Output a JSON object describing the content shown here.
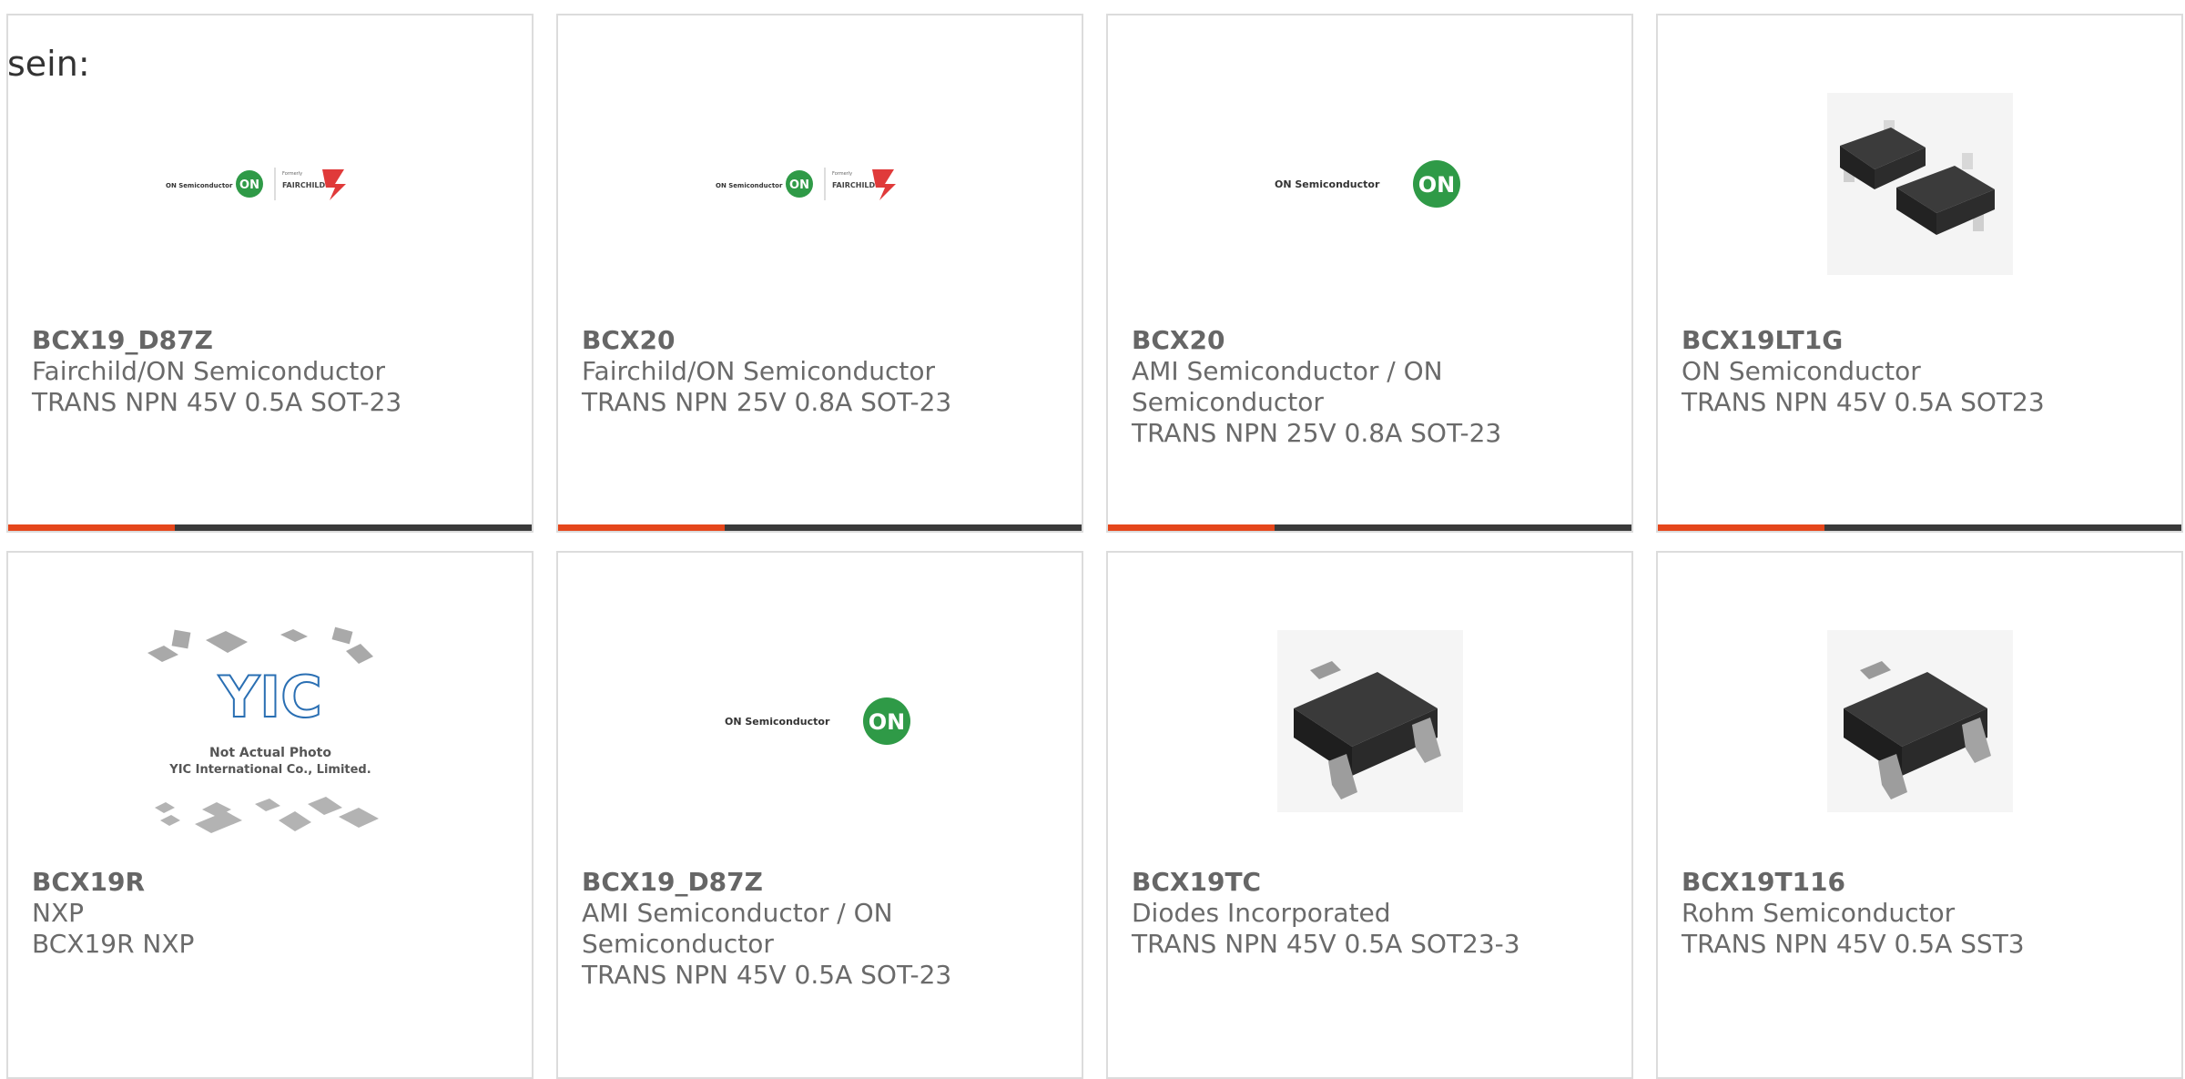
{
  "intro": "sein:",
  "accent_color": "#e5461b",
  "bar_color": "#3a3a3a",
  "products": [
    {
      "part": "BCX19_D87Z",
      "manufacturer": "Fairchild/ON Semiconductor",
      "description": "TRANS NPN 45V 0.5A SOT-23",
      "image": "on-fairchild-logo",
      "logo_on_text": "ON Semiconductor",
      "logo_on_mark": "ON",
      "logo_fc_small": "Formerly",
      "logo_fc_text": "FAIRCHILD."
    },
    {
      "part": "BCX20",
      "manufacturer": "Fairchild/ON Semiconductor",
      "description": "TRANS NPN 25V 0.8A SOT-23",
      "image": "on-fairchild-logo",
      "logo_on_text": "ON Semiconductor",
      "logo_on_mark": "ON",
      "logo_fc_small": "Formerly",
      "logo_fc_text": "FAIRCHILD."
    },
    {
      "part": "BCX20",
      "manufacturer": "AMI Semiconductor / ON Semiconductor",
      "description": "TRANS NPN 25V 0.8A SOT-23",
      "image": "on-semiconductor-logo",
      "logo_on_text": "ON Semiconductor",
      "logo_on_mark": "ON"
    },
    {
      "part": "BCX19LT1G",
      "manufacturer": "ON Semiconductor",
      "description": "TRANS NPN 45V 0.5A SOT23",
      "image": "sot23-package-photo"
    },
    {
      "part": "BCX19R",
      "manufacturer": "NXP",
      "description": "BCX19R NXP",
      "image": "not-actual-photo-placeholder",
      "placeholder_logo": "YIC",
      "placeholder_line1": "Not Actual Photo",
      "placeholder_line2": "YIC International Co., Limited."
    },
    {
      "part": "BCX19_D87Z",
      "manufacturer": "AMI Semiconductor / ON Semiconductor",
      "description": "TRANS NPN 45V 0.5A SOT-23",
      "image": "on-semiconductor-logo",
      "logo_on_text": "ON Semiconductor",
      "logo_on_mark": "ON"
    },
    {
      "part": "BCX19TC",
      "manufacturer": "Diodes Incorporated",
      "description": "TRANS NPN 45V 0.5A SOT23-3",
      "image": "sot23-package-photo"
    },
    {
      "part": "BCX19T116",
      "manufacturer": "Rohm Semiconductor",
      "description": "TRANS NPN 45V 0.5A SST3",
      "image": "sot23-package-photo"
    }
  ]
}
